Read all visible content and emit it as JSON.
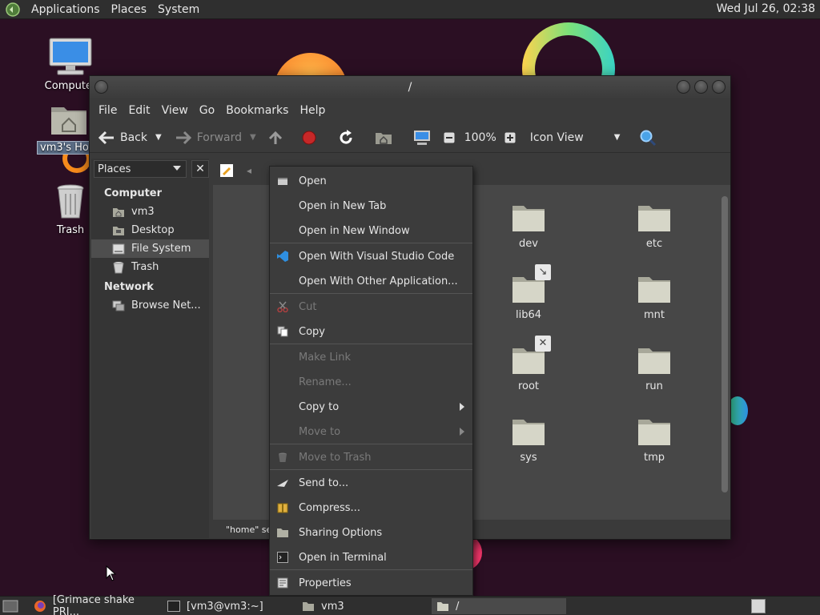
{
  "top_panel": {
    "menus": [
      "Applications",
      "Places",
      "System"
    ],
    "clock": "Wed Jul 26, 02:38"
  },
  "desktop_icons": {
    "computer": "Computer",
    "home": "vm3's Home",
    "trash": "Trash"
  },
  "window": {
    "title": "/",
    "menu": [
      "File",
      "Edit",
      "View",
      "Go",
      "Bookmarks",
      "Help"
    ],
    "toolbar": {
      "back": "Back",
      "forward": "Forward",
      "zoom": "100%",
      "view_mode": "Icon View"
    },
    "sidebar": {
      "combo_label": "Places",
      "close_glyph": "✕",
      "computer_heading": "Computer",
      "computer_items": [
        "vm3",
        "Desktop",
        "File System",
        "Trash"
      ],
      "network_heading": "Network",
      "network_items": [
        "Browse Net..."
      ],
      "selected": "File System"
    },
    "folders": [
      {
        "name": "dev"
      },
      {
        "name": "etc"
      },
      {
        "name": "lib64",
        "badge": "link"
      },
      {
        "name": "mnt"
      },
      {
        "name": "root",
        "badge": "no-access"
      },
      {
        "name": "run"
      },
      {
        "name": "sys"
      },
      {
        "name": "tmp"
      }
    ],
    "status": "\"home\" sel"
  },
  "context_menu": {
    "open": "Open",
    "open_new_tab": "Open in New Tab",
    "open_new_window": "Open in New Window",
    "open_vscode": "Open With Visual Studio Code",
    "open_other": "Open With Other Application...",
    "cut": "Cut",
    "copy": "Copy",
    "make_link": "Make Link",
    "rename": "Rename...",
    "copy_to": "Copy to",
    "move_to": "Move to",
    "move_to_trash": "Move to Trash",
    "send_to": "Send to...",
    "compress": "Compress...",
    "sharing_options": "Sharing Options",
    "open_terminal": "Open in Terminal",
    "properties": "Properties"
  },
  "taskbar": {
    "tasks": [
      "[Grimace shake PRI...",
      "[vm3@vm3:~]",
      "vm3",
      "/"
    ]
  }
}
